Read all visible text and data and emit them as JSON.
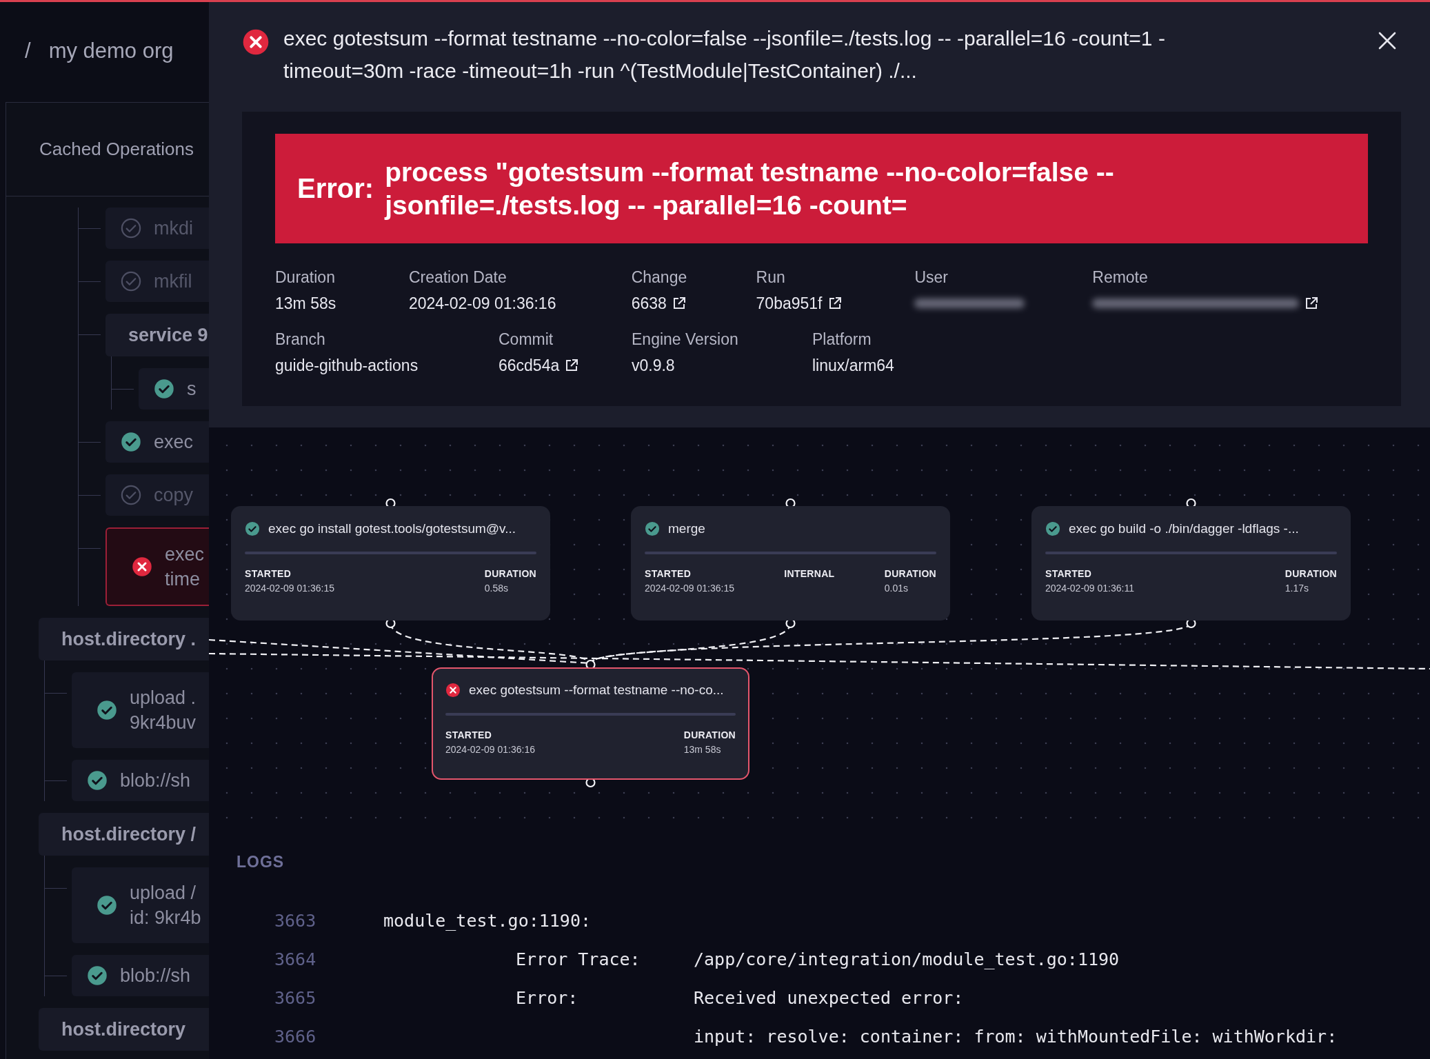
{
  "sidebar": {
    "separator": "/",
    "org": "my demo org",
    "panel_title": "Cached Operations",
    "tree": [
      {
        "kind": "branch",
        "children": [
          {
            "kind": "step",
            "cached": true,
            "failed": false,
            "lines": [
              "mkdi"
            ]
          },
          {
            "kind": "step",
            "cached": true,
            "failed": false,
            "lines": [
              "mkfil"
            ]
          },
          {
            "kind": "group",
            "label": "service 9",
            "children": [
              {
                "kind": "step",
                "cached": false,
                "failed": false,
                "lines": [
                  "s"
                ]
              }
            ]
          },
          {
            "kind": "step",
            "cached": false,
            "failed": false,
            "lines": [
              "exec"
            ]
          },
          {
            "kind": "step",
            "cached": true,
            "failed": false,
            "lines": [
              "copy"
            ]
          },
          {
            "kind": "step",
            "cached": false,
            "failed": true,
            "lines": [
              "exec",
              "time"
            ]
          }
        ]
      },
      {
        "kind": "group",
        "label": "host.directory .",
        "children": [
          {
            "kind": "step",
            "cached": false,
            "failed": false,
            "lines": [
              "upload .",
              "9kr4buv"
            ]
          },
          {
            "kind": "step",
            "cached": false,
            "failed": false,
            "lines": [
              "blob://sh"
            ]
          }
        ]
      },
      {
        "kind": "group",
        "label": "host.directory /",
        "children": [
          {
            "kind": "step",
            "cached": false,
            "failed": false,
            "lines": [
              "upload /",
              "id: 9kr4b"
            ]
          },
          {
            "kind": "step",
            "cached": false,
            "failed": false,
            "lines": [
              "blob://sh"
            ]
          }
        ]
      },
      {
        "kind": "group",
        "label": "host.directory"
      }
    ]
  },
  "modal": {
    "failed": true,
    "title": "exec gotestsum --format testname --no-color=false --jsonfile=./tests.log -- -parallel=16 -count=1 -timeout=30m -race -timeout=1h -run ^(TestModule|TestContainer) ./...",
    "error_label": "Error:",
    "error_message": "process \"gotestsum --format testname --no-color=false --jsonfile=./tests.log -- -parallel=16 -count=",
    "details": [
      [
        {
          "label": "Duration",
          "value": "13m 58s",
          "link": false,
          "redacted": false
        },
        {
          "label": "Creation Date",
          "value": "2024-02-09 01:36:16",
          "link": false,
          "redacted": false
        },
        {
          "label": "Change",
          "value": "6638",
          "link": true,
          "redacted": false
        },
        {
          "label": "Run",
          "value": "70ba951f",
          "link": true,
          "redacted": false
        },
        {
          "label": "User",
          "link": false,
          "redacted": true
        },
        {
          "label": "Remote",
          "link": true,
          "redacted": true
        }
      ],
      [
        {
          "label": "Branch",
          "value": "guide-github-actions",
          "link": false,
          "redacted": false
        },
        {
          "label": "Commit",
          "value": "66cd54a",
          "link": true,
          "redacted": false
        },
        {
          "label": "Engine Version",
          "value": "v0.9.8",
          "link": false,
          "redacted": false
        },
        {
          "label": "Platform",
          "value": "linux/arm64",
          "link": false,
          "redacted": false
        }
      ]
    ]
  },
  "graph": {
    "nodes": [
      {
        "failed": false,
        "title": "exec go install gotest.tools/gotestsum@v...",
        "fields": [
          {
            "label": "STARTED",
            "value": "2024-02-09 01:36:15"
          },
          {
            "label": "DURATION",
            "value": "0.58s"
          }
        ]
      },
      {
        "failed": false,
        "title": "merge",
        "fields": [
          {
            "label": "STARTED",
            "value": "2024-02-09 01:36:15"
          },
          {
            "label": "INTERNAL"
          },
          {
            "label": "DURATION",
            "value": "0.01s"
          }
        ]
      },
      {
        "failed": false,
        "title": "exec go build -o ./bin/dagger -ldflags -...",
        "fields": [
          {
            "label": "STARTED",
            "value": "2024-02-09 01:36:11"
          },
          {
            "label": "DURATION",
            "value": "1.17s"
          }
        ]
      },
      {
        "failed": true,
        "title": "exec gotestsum --format testname --no-co...",
        "fields": [
          {
            "label": "STARTED",
            "value": "2024-02-09 01:36:16"
          },
          {
            "label": "DURATION",
            "value": "13m 58s"
          }
        ]
      }
    ]
  },
  "logs": {
    "title": "LOGS",
    "lines": [
      {
        "kind": "heading",
        "number": "3663",
        "text": "module_test.go:1190:"
      },
      {
        "kind": "field",
        "number": "3664",
        "label": "Error Trace:",
        "text": "/app/core/integration/module_test.go:1190"
      },
      {
        "kind": "field",
        "number": "3665",
        "label": "Error:",
        "text": "Received unexpected error:"
      },
      {
        "kind": "continuation",
        "number": "3666",
        "text": "input: resolve: container: from: withMountedFile: withWorkdir:"
      }
    ]
  }
}
